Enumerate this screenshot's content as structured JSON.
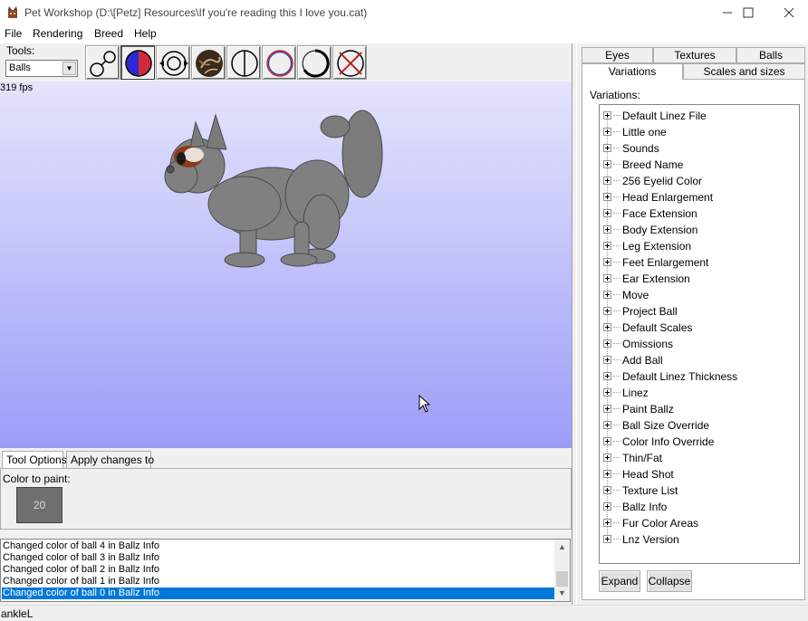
{
  "window": {
    "title": "Pet Workshop (D:\\[Petz] Resources\\If you're reading this I love you.cat)",
    "minimize_icon": "minimize-icon",
    "maximize_icon": "maximize-icon",
    "close_icon": "close-icon"
  },
  "menu": [
    "File",
    "Rendering",
    "Breed",
    "Help"
  ],
  "tools": {
    "label": "Tools:",
    "selected": "Balls",
    "buttons": [
      {
        "icon": "ball-link-icon"
      },
      {
        "icon": "paint-color-icon"
      },
      {
        "icon": "resize-ball-icon"
      },
      {
        "icon": "texture-icon"
      },
      {
        "icon": "half-circle-icon"
      },
      {
        "icon": "outline-color-icon"
      },
      {
        "icon": "outline-thickness-icon"
      },
      {
        "icon": "omit-ball-icon"
      }
    ]
  },
  "viewport": {
    "fps": "319 fps"
  },
  "tool_options": {
    "tabs": [
      "Tool Options",
      "Apply changes to"
    ],
    "color_label": "Color to paint:",
    "color_value": "20",
    "color_hex": "#6f6f6f"
  },
  "log": [
    "Changed color of ball 4 in Ballz Info",
    "Changed color of ball 3 in Ballz Info",
    "Changed color of ball 2 in Ballz Info",
    "Changed color of ball 1 in Ballz Info",
    "Changed color of ball 0 in Ballz Info"
  ],
  "status": "ankleL",
  "right_tabs": {
    "row1": [
      "Eyes",
      "Textures",
      "Balls"
    ],
    "row2": [
      "Variations",
      "Scales and sizes"
    ]
  },
  "variations": {
    "label": "Variations:",
    "items": [
      "Default Linez File",
      "Little one",
      "Sounds",
      "Breed Name",
      "256 Eyelid Color",
      "Head Enlargement",
      "Face Extension",
      "Body Extension",
      "Leg Extension",
      "Feet Enlargement",
      "Ear Extension",
      "Move",
      "Project Ball",
      "Default Scales",
      "Omissions",
      "Add Ball",
      "Default Linez Thickness",
      "Linez",
      "Paint Ballz",
      "Ball Size Override",
      "Color Info Override",
      "Thin/Fat",
      "Head Shot",
      "Texture List",
      "Ballz Info",
      "Fur Color Areas",
      "Lnz Version"
    ],
    "expand": "Expand",
    "collapse": "Collapse"
  },
  "colors": {
    "selection": "#0078d7",
    "viewport_top": "#e4e4fc",
    "viewport_bottom": "#9c9cf8"
  }
}
